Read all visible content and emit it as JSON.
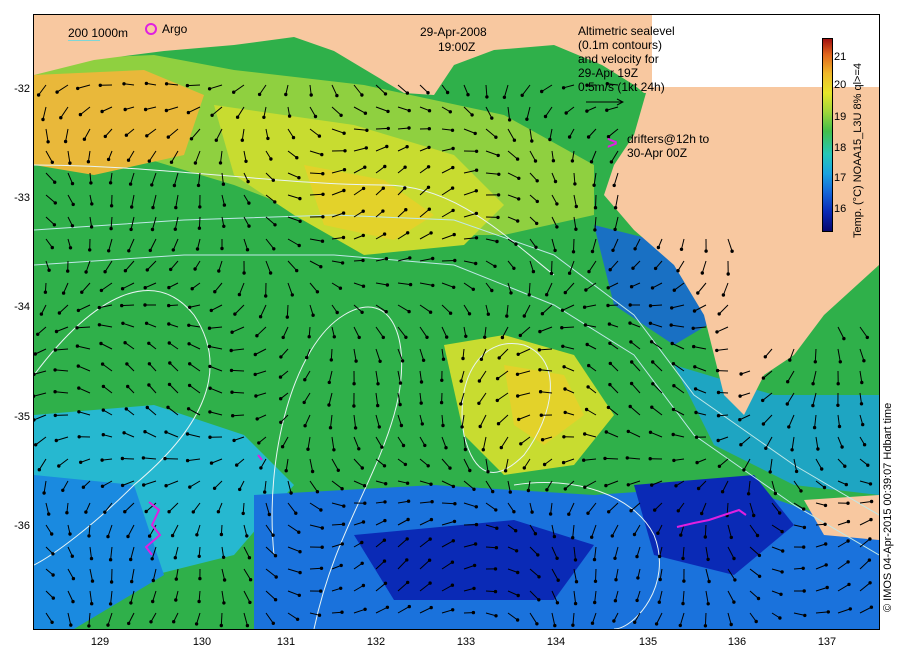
{
  "header": {
    "date": "29-Apr-2008",
    "time": "19:00Z"
  },
  "legend": {
    "isobath_label": "200  1000m",
    "argo_label": "Argo",
    "altimetry_lines": [
      "Altimetric sealevel",
      "(0.1m contours)",
      "and velocity for",
      "29-Apr 19Z",
      "0.5m/s (1kt 24h)"
    ],
    "drifters_lines": [
      "drifters@12h to",
      "30-Apr 00Z"
    ],
    "drifter_glyph": ">"
  },
  "colorbar": {
    "title": "Temp. (°C) NOAA15_L3U 8% ql>=4",
    "ticks": [
      "21",
      "20",
      "19",
      "18",
      "17",
      "16"
    ]
  },
  "credit": "© IMOS 04-Apr-2015 00:39:07 Hdbart time",
  "axes": {
    "lat_ticks": [
      "-32",
      "-33",
      "-34",
      "-35",
      "-36"
    ],
    "lon_ticks": [
      "129",
      "130",
      "131",
      "132",
      "133",
      "134",
      "135",
      "136",
      "137"
    ]
  },
  "colors": {
    "land": "#f8c8a0",
    "sea_green": "#2fb04a",
    "isobath": "#bfe8e8",
    "contour": "#e8f4f4",
    "drifter": "#e020e0"
  }
}
